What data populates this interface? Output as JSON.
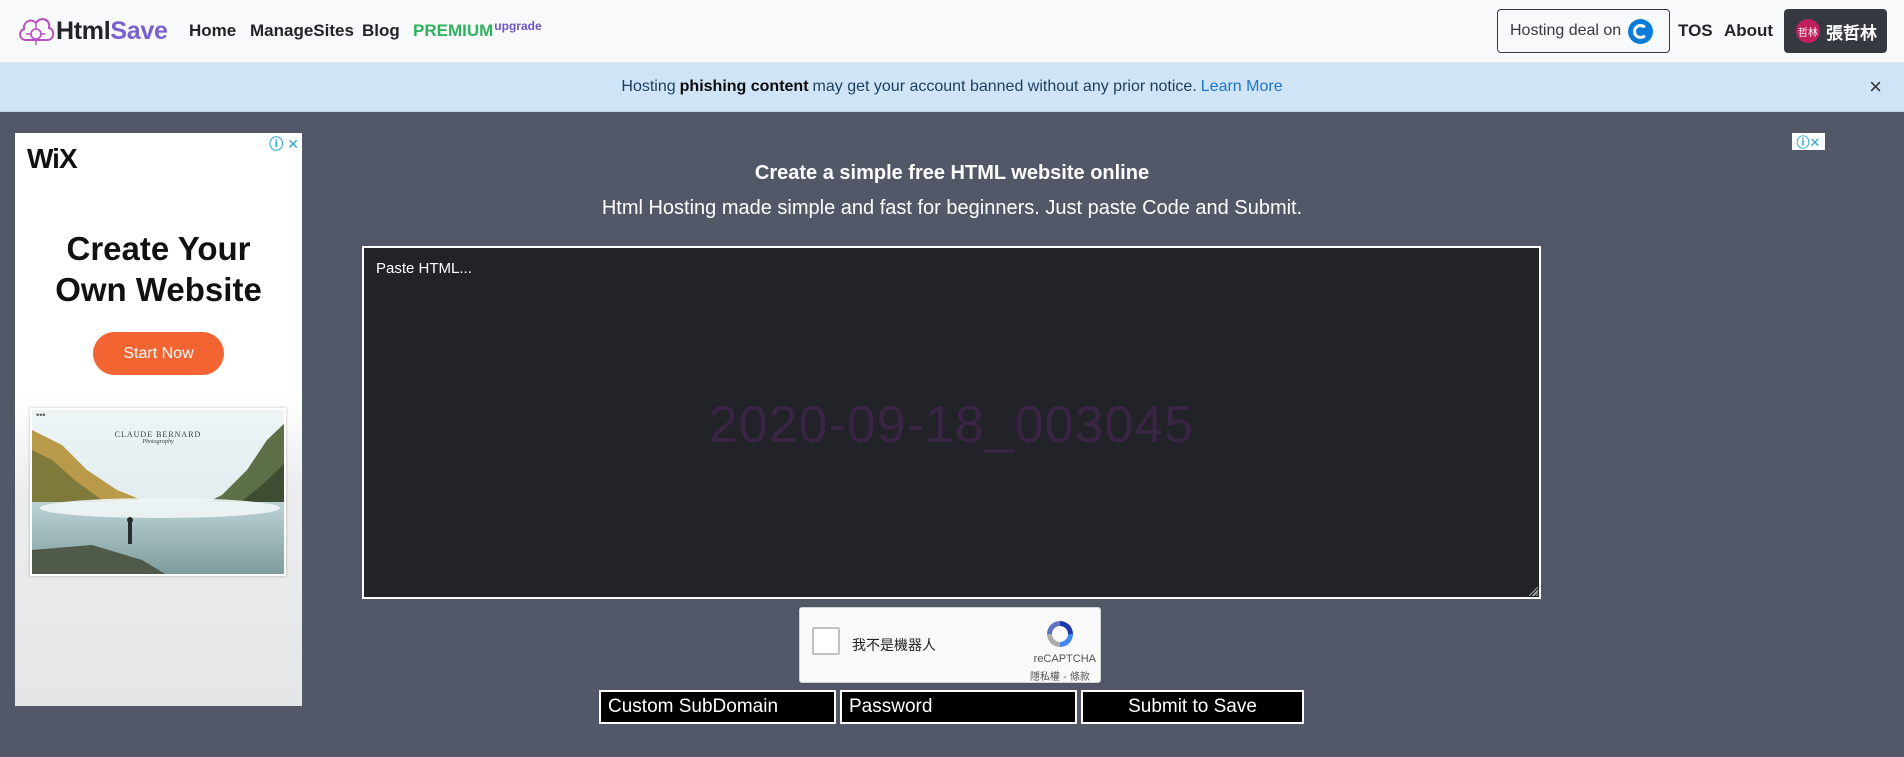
{
  "navbar": {
    "brand_prefix": "Html",
    "brand_suffix": "Save",
    "links": {
      "home": "Home",
      "manage_sites": "ManageSites",
      "blog": "Blog",
      "premium": "PREMIUM",
      "premium_sup": "upgrade",
      "tos": "TOS",
      "about": "About"
    },
    "hosting_deal": "Hosting deal on",
    "user": {
      "avatar_text": "哲林",
      "name": "張哲林"
    }
  },
  "alert": {
    "prefix": "Hosting",
    "bold": "phishing content",
    "suffix": "may get your account banned without any prior notice.",
    "link": "Learn More",
    "close": "×"
  },
  "ad_left": {
    "logo": "WiX",
    "headline_line1": "Create Your",
    "headline_line2": "Own Website",
    "cta": "Start Now",
    "image_caption_1": "CLAUDE BERNARD",
    "image_caption_2": "Photography",
    "image_dots": "•••",
    "info_icon": "ⓘ",
    "close_icon": "✕"
  },
  "ad_right": {
    "badge": "ⓘ✕"
  },
  "main": {
    "title": "Create a simple free HTML website online",
    "subtitle": "Html Hosting made simple and fast for beginners. Just paste Code and Submit.",
    "editor_placeholder": "Paste HTML...",
    "editor_watermark": "2020-09-18_003045"
  },
  "recaptcha": {
    "label": "我不是機器人",
    "brand": "reCAPTCHA",
    "links": "隱私權 - 條款"
  },
  "form": {
    "subdomain_placeholder": "Custom SubDomain",
    "password_placeholder": "Password",
    "submit": "Submit to Save"
  },
  "colors": {
    "page_bg": "#535869",
    "navbar_bg": "#f8f9fa",
    "alert_bg": "#cfe4f7",
    "editor_bg": "#212329",
    "premium_green": "#2db35d",
    "brand_accent": "#7a5fd0",
    "wix_cta": "#f26432"
  }
}
